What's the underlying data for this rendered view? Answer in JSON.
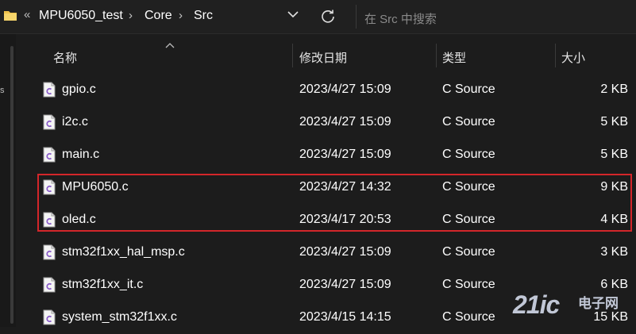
{
  "breadcrumb": {
    "overflow_glyph": "«",
    "items": [
      "MPU6050_test",
      "Core",
      "Src"
    ],
    "separator": "›"
  },
  "search": {
    "placeholder": "在 Src 中搜索"
  },
  "nav": {
    "glyph": "s"
  },
  "columns": {
    "name": "名称",
    "modified": "修改日期",
    "type": "类型",
    "size": "大小"
  },
  "files": [
    {
      "name": "gpio.c",
      "modified": "2023/4/27 15:09",
      "type": "C Source",
      "size": "2 KB"
    },
    {
      "name": "i2c.c",
      "modified": "2023/4/27 15:09",
      "type": "C Source",
      "size": "5 KB"
    },
    {
      "name": "main.c",
      "modified": "2023/4/27 15:09",
      "type": "C Source",
      "size": "5 KB"
    },
    {
      "name": "MPU6050.c",
      "modified": "2023/4/27 14:32",
      "type": "C Source",
      "size": "9 KB"
    },
    {
      "name": "oled.c",
      "modified": "2023/4/17 20:53",
      "type": "C Source",
      "size": "4 KB"
    },
    {
      "name": "stm32f1xx_hal_msp.c",
      "modified": "2023/4/27 15:09",
      "type": "C Source",
      "size": "3 KB"
    },
    {
      "name": "stm32f1xx_it.c",
      "modified": "2023/4/27 15:09",
      "type": "C Source",
      "size": "6 KB"
    },
    {
      "name": "system_stm32f1xx.c",
      "modified": "2023/4/15 14:15",
      "type": "C Source",
      "size": "15 KB"
    }
  ],
  "watermark": {
    "number": "21ic",
    "text": "电子网"
  },
  "colors": {
    "background": "#1c1c1c",
    "highlight": "#d3262a",
    "folder": "#f0c24a"
  }
}
